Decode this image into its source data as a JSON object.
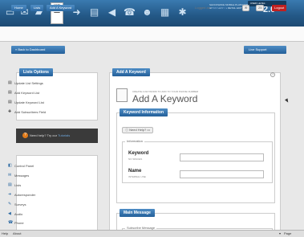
{
  "topbar": {
    "active_label": "LISTS",
    "brand_line1": "SHOCKWAVE MOBILE PLATFORM",
    "brand_line2": "HOSPITALITY & RETAIL EDITION",
    "brand_version": "2.0",
    "user_level": "USER LEVEL:"
  },
  "nav": {
    "crumbs": [
      "Home",
      "Lists",
      "Add A Keyword"
    ],
    "logged_prefix": "Logged as:",
    "logged_name": "John (702)",
    "badge_a": "25",
    "logout": "Logout"
  },
  "buttons": {
    "back": "« Back to Dashboard",
    "live": "Live Support"
  },
  "lists_options": {
    "title": "Lists Options",
    "items": [
      "Update List Settings",
      "Add Keyword List",
      "Update Keyword List",
      "Add Subscribers Field"
    ]
  },
  "help": {
    "text": "Need help? Try our",
    "link": "Tutorials"
  },
  "nav_menu": {
    "items": [
      "Control Panel",
      "Messages",
      "Lists",
      "Autoresponder",
      "Surveys",
      "Audio",
      "Phone",
      "Subscribers"
    ]
  },
  "main": {
    "header": "Add A Keyword",
    "pretitle": "CREATE A KEYWORD TO ADD TO YOUR PHONE NUMBER",
    "title": "Add A Keyword",
    "keyword_section": "Keyword Information",
    "need_help": "Need Help?",
    "info_legend": "Information",
    "keyword_label": "Keyword",
    "keyword_sub": "NO SPACES",
    "name_label": "Name",
    "name_sub": "INTERNAL USE",
    "main_message": "Main Message",
    "subscribe_message": "Subscribe Message"
  },
  "statusbar": {
    "help": "Help",
    "about": "About",
    "page": "Page"
  }
}
